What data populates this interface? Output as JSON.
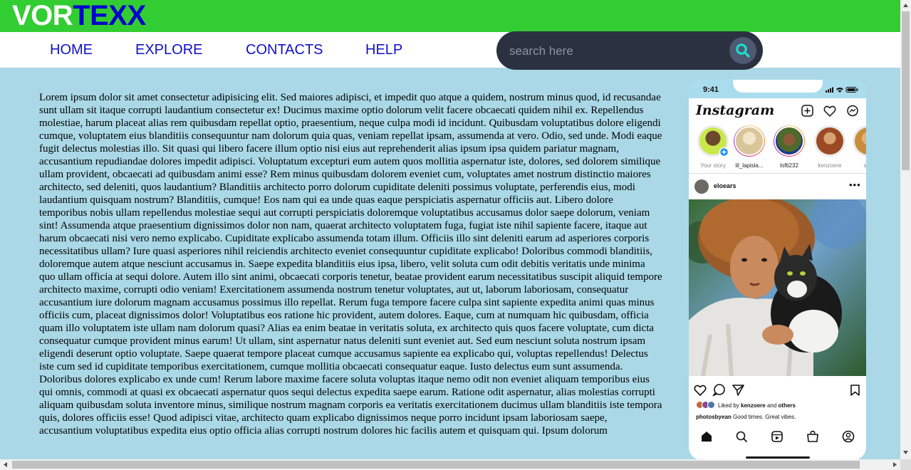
{
  "logo": {
    "part1": "VOR",
    "part2": "TEXX"
  },
  "nav": {
    "items": [
      "HOME",
      "EXPLORE",
      "CONTACTS",
      "HELP"
    ]
  },
  "search": {
    "placeholder": "search here",
    "icon": "search-icon"
  },
  "article": {
    "text": "Lorem ipsum dolor sit amet consectetur adipisicing elit. Sed maiores adipisci, et impedit quo atque a quidem, nostrum minus quod, id recusandae sunt ullam sit itaque corrupti laudantium consectetur ex! Ducimus maxime optio dolorum velit facere obcaecati quidem nihil ex. Repellendus molestiae, harum placeat alias rem quibusdam repellat optio, praesentium, neque culpa modi id incidunt. Quibusdam voluptatibus dolore eligendi cumque, voluptatem eius blanditiis consequuntur nam dolorum quia quas, veniam repellat ipsam, assumenda at vero. Odio, sed unde. Modi eaque fugit delectus molestias illo. Sit quasi qui libero facere illum optio nisi eius aut reprehenderit alias ipsum ipsa quidem pariatur magnam, accusantium repudiandae dolores impedit adipisci. Voluptatum excepturi eum autem quos mollitia aspernatur iste, dolores, sed dolorem similique ullam provident, obcaecati ad quibusdam animi esse? Rem minus quibusdam dolorem eveniet cum, voluptates amet nostrum distinctio maiores architecto, sed deleniti, quos laudantium? Blanditiis architecto porro dolorum cupiditate deleniti possimus voluptate, perferendis eius, modi laudantium quisquam nostrum? Blanditiis, cumque! Eos nam qui ea unde quas eaque perspiciatis aspernatur officiis aut. Libero dolore temporibus nobis ullam repellendus molestiae sequi aut corrupti perspiciatis doloremque voluptatibus accusamus dolor saepe dolorum, veniam sint! Assumenda atque praesentium dignissimos dolor non nam, quaerat architecto voluptatem fuga, fugiat iste nihil sapiente facere, itaque aut harum obcaecati nisi vero nemo explicabo. Cupiditate explicabo assumenda totam illum. Officiis illo sint deleniti earum ad asperiores corporis necessitatibus ullam? Iure quasi asperiores nihil reiciendis architecto eveniet consequuntur cupiditate explicabo! Doloribus commodi blanditiis, doloremque autem atque nesciunt accusamus in. Saepe expedita blanditiis eius ipsa, libero, velit soluta cum odit debitis veritatis unde minima quo ullam officia at sequi dolore. Autem illo sint animi, obcaecati corporis tenetur, beatae provident earum necessitatibus suscipit aliquid tempore architecto maxime, corrupti odio veniam! Exercitationem assumenda nostrum tenetur voluptates, aut ut, laborum laboriosam, consequatur accusantium iure dolorum magnam accusamus possimus illo repellat. Rerum fuga tempore facere culpa sint sapiente expedita animi quas minus officiis cum, placeat dignissimos dolor! Voluptatibus eos ratione hic provident, autem dolores. Eaque, cum at numquam hic quibusdam, officia quam illo voluptatem iste ullam nam dolorum quasi? Alias ea enim beatae in veritatis soluta, ex architecto quis quos facere voluptate, cum dicta consequatur cumque provident minus earum! Ut ullam, sint aspernatur natus deleniti sunt eveniet aut. Sed eum nesciunt soluta nostrum ipsam eligendi deserunt optio voluptate. Saepe quaerat tempore placeat cumque accusamus sapiente ea explicabo qui, voluptas repellendus! Delectus iste cum sed id cupiditate temporibus exercitationem, cumque mollitia obcaecati consequatur eaque. Iusto delectus eum sunt assumenda. Doloribus dolores explicabo ex unde cum! Rerum labore maxime facere soluta voluptas itaque nemo odit non eveniet aliquam temporibus eius qui omnis, commodi at quasi ex obcaecati aspernatur quos sequi delectus expedita saepe earum. Ratione odit aspernatur, alias molestias corrupti aliquam quibusdam soluta inventore minus, similique nostrum magnam corporis ea veritatis exercitationem ducimus ullam blanditiis iste tempora quis, dolores officiis esse! Quod adipisci vitae, architecto quam explicabo dignissimos neque porro incidunt ipsam laboriosam saepe, accusantium voluptatibus expedita eius optio officia alias corrupti nostrum dolores hic facilis autem et quisquam qui. Ipsum dolorum"
  },
  "phone": {
    "time": "9:41",
    "app_logo": "Instagram",
    "stories": [
      {
        "label": "Your story",
        "ring": "none"
      },
      {
        "label": "lil_lapisla...",
        "ring": "gradient"
      },
      {
        "label": "lofti232",
        "ring": "gradient"
      },
      {
        "label": "kenzoere",
        "ring": "none"
      },
      {
        "label": "sap",
        "ring": "none"
      }
    ],
    "post": {
      "username": "eloears",
      "liked_prefix": "Liked by ",
      "liked_user": "kenzoere",
      "liked_mid": " and ",
      "liked_suffix": "others",
      "caption_user": "photosbyean",
      "caption_text": " Good times. Great vibes."
    }
  },
  "colors": {
    "header": "#32cd32",
    "nav_link": "#1010cc",
    "background": "#aad8e6",
    "search_bg": "#2b3140"
  }
}
